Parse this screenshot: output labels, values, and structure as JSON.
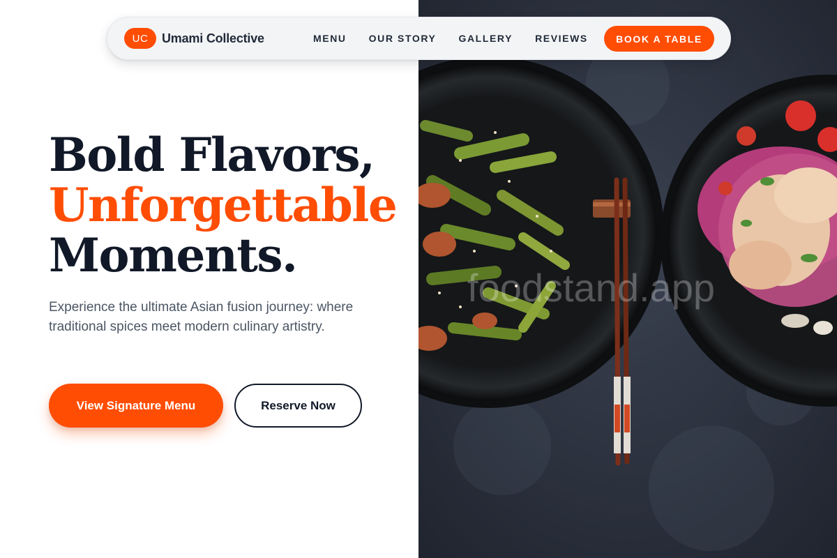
{
  "brand": {
    "badge": "UC",
    "name": "Umami Collective"
  },
  "nav": {
    "links": [
      "MENU",
      "OUR STORY",
      "GALLERY",
      "REVIEWS"
    ],
    "cta": "BOOK A TABLE"
  },
  "hero": {
    "headline_line1": "Bold Flavors,",
    "headline_line2": "Unforgettable",
    "headline_line3": "Moments.",
    "subtext": "Experience the ultimate Asian fusion journey: where traditional spices meet modern culinary artistry.",
    "primary_button": "View Signature Menu",
    "secondary_button": "Reserve Now"
  },
  "photo": {
    "watermark": "foodstand.app",
    "description_icon": "food-bowls-photo"
  },
  "colors": {
    "accent": "#ff4d04",
    "text_dark": "#111827",
    "text_muted": "#4b5563",
    "nav_bg": "#f3f4f6"
  }
}
